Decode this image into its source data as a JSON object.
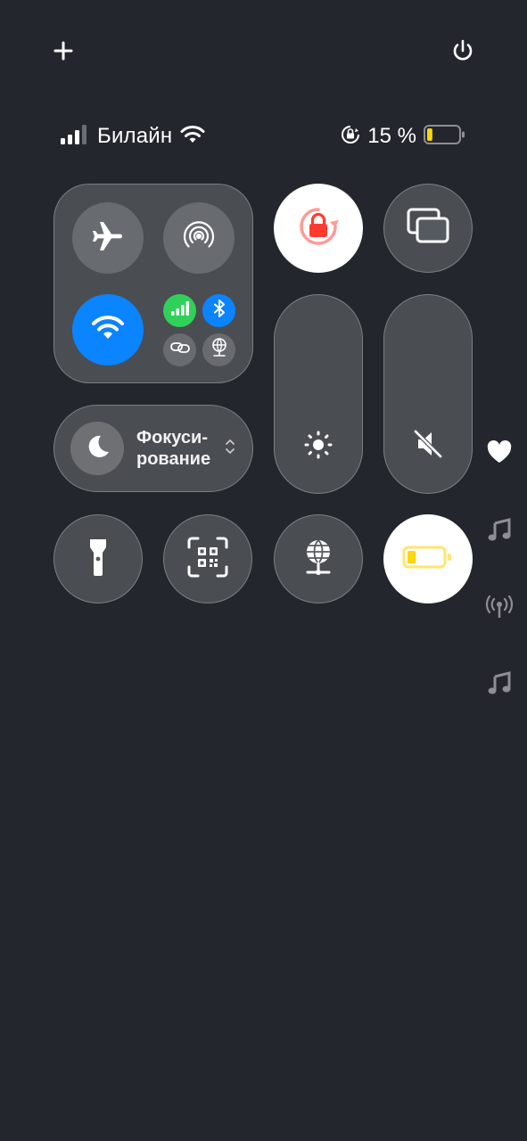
{
  "top_actions": {
    "add_icon": "plus-icon",
    "power_icon": "power-icon"
  },
  "status_bar": {
    "signal_bars_active": 3,
    "signal_bars_total": 4,
    "carrier": "Билайн",
    "wifi_icon": "wifi-icon",
    "orientation_lock_icon": "orientation-lock-icon",
    "battery_percent": "15 %",
    "battery_level": 0.15,
    "battery_color": "#ffd60a"
  },
  "connectivity": {
    "airplane": {
      "icon": "airplane-icon",
      "active": false
    },
    "airdrop": {
      "icon": "airdrop-icon",
      "active": false
    },
    "wifi": {
      "icon": "wifi-icon",
      "active": true,
      "color": "#0a84ff"
    },
    "cellular": {
      "icon": "cellular-icon",
      "active": true,
      "color": "#30d158"
    },
    "bluetooth": {
      "icon": "bluetooth-icon",
      "active": true,
      "color": "#0a84ff"
    },
    "link": {
      "icon": "link-icon",
      "active": false
    },
    "network": {
      "icon": "globe-network-icon",
      "active": false
    }
  },
  "focus": {
    "label": "Фокуси-рование",
    "label_line1": "Фокуси-",
    "label_line2": "рование",
    "icon": "moon-icon"
  },
  "tiles": {
    "orientation_lock": {
      "icon": "lock-rotation-icon",
      "active": true,
      "color": "#ff3b30"
    },
    "screen_mirroring": {
      "icon": "screen-mirroring-icon",
      "active": false
    },
    "flashlight": {
      "icon": "flashlight-icon"
    },
    "qr_scanner": {
      "icon": "qr-code-icon"
    },
    "network_globe": {
      "icon": "globe-network-icon"
    },
    "low_power": {
      "icon": "battery-icon",
      "active": true,
      "color": "#ffd60a"
    }
  },
  "sliders": {
    "brightness": {
      "icon": "sun-icon",
      "level": 0
    },
    "volume": {
      "icon": "speaker-muted-icon",
      "level": 0
    }
  },
  "side_pages": [
    "heart-icon",
    "music-note-icon",
    "antenna-icon",
    "music-note-icon"
  ],
  "colors": {
    "background": "#23272d",
    "accent_blue": "#0a84ff",
    "accent_green": "#30d158",
    "accent_red": "#ff3b30",
    "accent_yellow": "#ffd60a"
  }
}
